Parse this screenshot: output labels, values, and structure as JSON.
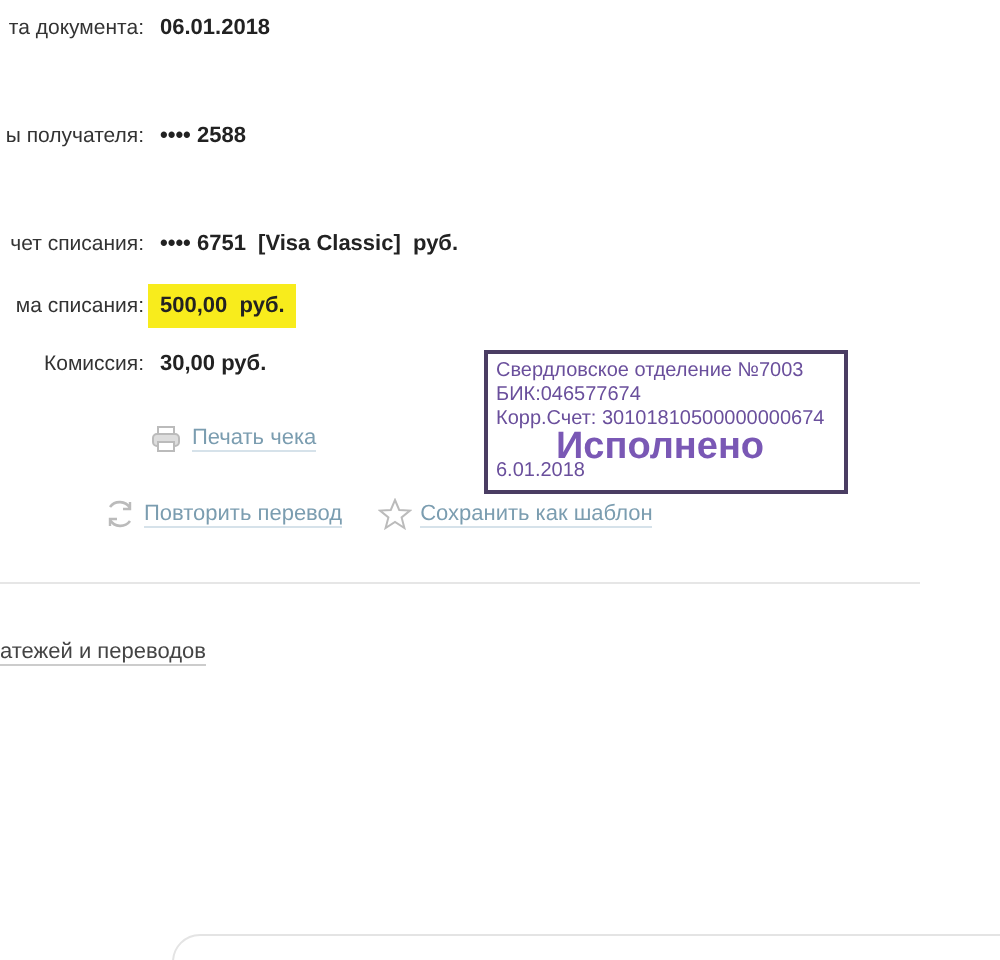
{
  "details": [
    {
      "label": "та документа:",
      "value": "06.01.2018",
      "highlighted": false
    },
    {
      "label": "ы получателя:",
      "value": "•••• 2588",
      "highlighted": false
    },
    {
      "label": "чет списания:",
      "value": "•••• 6751  [Visa Classic]  руб.",
      "highlighted": false
    },
    {
      "label": "ма списания:",
      "value": "500,00  руб.",
      "highlighted": true
    },
    {
      "label": "Комиссия:",
      "value": "30,00 руб.",
      "highlighted": false
    }
  ],
  "stamp": {
    "lines": [
      "Свердловское отделение №7003",
      "БИК:046577674",
      "Корр.Счет: 30101810500000000674"
    ],
    "status": "Исполнено",
    "date": "6.01.2018"
  },
  "print_link": "Печать чека",
  "actions": [
    {
      "kind": "repeat",
      "label": "Повторить перевод"
    },
    {
      "kind": "star",
      "label": "Сохранить как шаблон"
    }
  ],
  "history_link": "атежей и переводов"
}
